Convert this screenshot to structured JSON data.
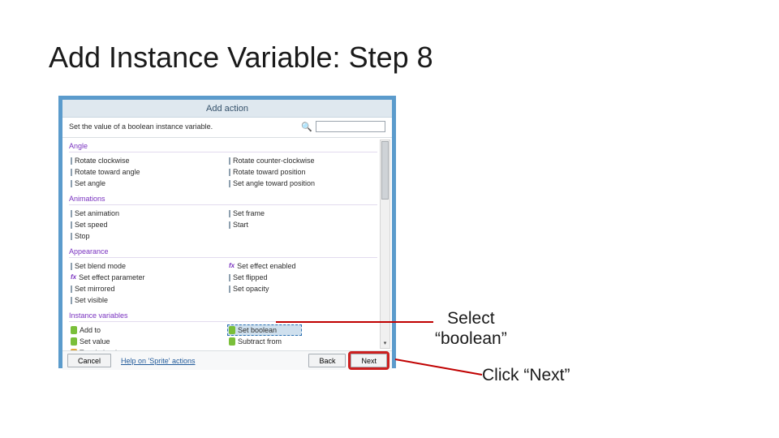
{
  "slide": {
    "title": "Add Instance Variable: Step 8",
    "callout1_l1": "Select",
    "callout1_l2": "“boolean”",
    "callout2": "Click “Next”"
  },
  "dialog": {
    "title": "Add action",
    "info": "Set the value of a boolean instance variable.",
    "search_placeholder": "",
    "footer_link": "Help on 'Sprite' actions",
    "btn_cancel": "Cancel",
    "btn_back": "Back",
    "btn_next": "Next"
  },
  "cats": {
    "angle": {
      "label": "Angle",
      "left": [
        "Rotate clockwise",
        "Rotate toward angle",
        "Set angle"
      ],
      "right": [
        "Rotate counter-clockwise",
        "Rotate toward position",
        "Set angle toward position"
      ]
    },
    "anim": {
      "label": "Animations",
      "left": [
        "Set animation",
        "Set speed",
        "Stop"
      ],
      "right": [
        "Set frame",
        "Start"
      ]
    },
    "appr": {
      "label": "Appearance",
      "left": [
        "Set blend mode",
        "Set effect parameter",
        "Set mirrored",
        "Set visible"
      ],
      "right": [
        "Set effect enabled",
        "Set flipped",
        "Set opacity"
      ]
    },
    "inst": {
      "label": "Instance variables",
      "left": [
        "Add to",
        "Set value",
        "Toggle boolean"
      ],
      "right": [
        "Set boolean",
        "Subtract from"
      ]
    }
  }
}
